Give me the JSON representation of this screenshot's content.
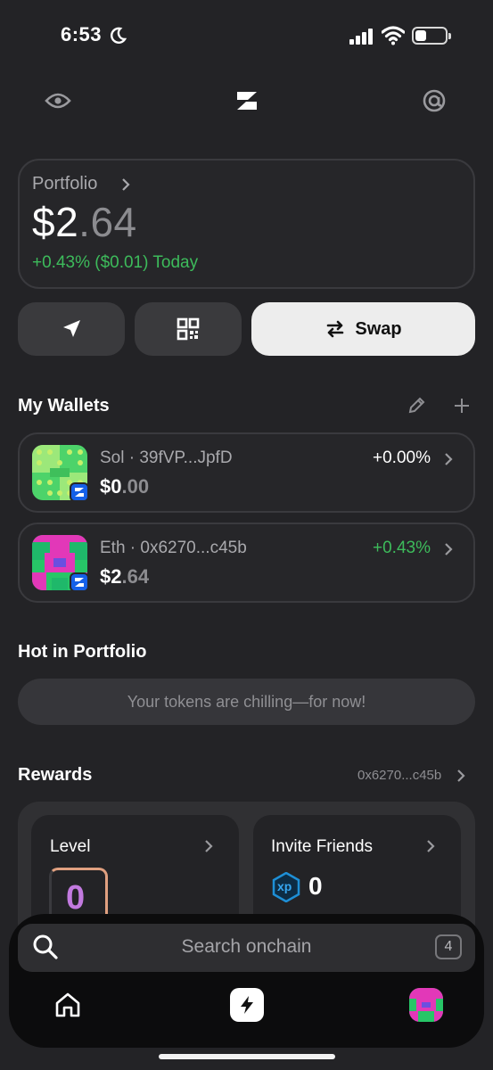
{
  "status_bar": {
    "time": "6:53"
  },
  "top_bar": {
    "left_icon": "eye-icon",
    "center_icon": "zerion-logo",
    "right_icon": "at-sign-icon"
  },
  "portfolio": {
    "label": "Portfolio",
    "balance_main": "$2",
    "balance_decimals": ".64",
    "change": "+0.43% ($0.01) Today"
  },
  "actions": {
    "send_icon": "send-icon",
    "receive_icon": "qr-code-icon",
    "swap_label": "Swap"
  },
  "wallets": {
    "title": "My Wallets",
    "items": [
      {
        "name": "Sol · 39fVP...JpfD",
        "balance_main": "$0",
        "balance_decimals": ".00",
        "change": "+0.00%",
        "change_color": "#ffffff"
      },
      {
        "name": "Eth · 0x6270...c45b",
        "balance_main": "$2",
        "balance_decimals": ".64",
        "change": "+0.43%",
        "change_color": "#3dbb5b"
      }
    ]
  },
  "hot": {
    "title": "Hot in Portfolio",
    "empty_text": "Your tokens are chilling—for now!"
  },
  "rewards": {
    "title": "Rewards",
    "address": "0x6270...c45b",
    "level_title": "Level",
    "level_value": "0",
    "invite_title": "Invite Friends",
    "xp_value": "0",
    "xp_badge": "xp"
  },
  "search": {
    "placeholder": "Search onchain",
    "shortcut": "4"
  },
  "tab_bar": {
    "home_icon": "home-icon",
    "center_icon": "lightning-icon",
    "profile_icon": "avatar-icon"
  },
  "colors": {
    "accent_green": "#3dbb5b",
    "badge_blue": "#1560e8",
    "background": "#232326"
  }
}
